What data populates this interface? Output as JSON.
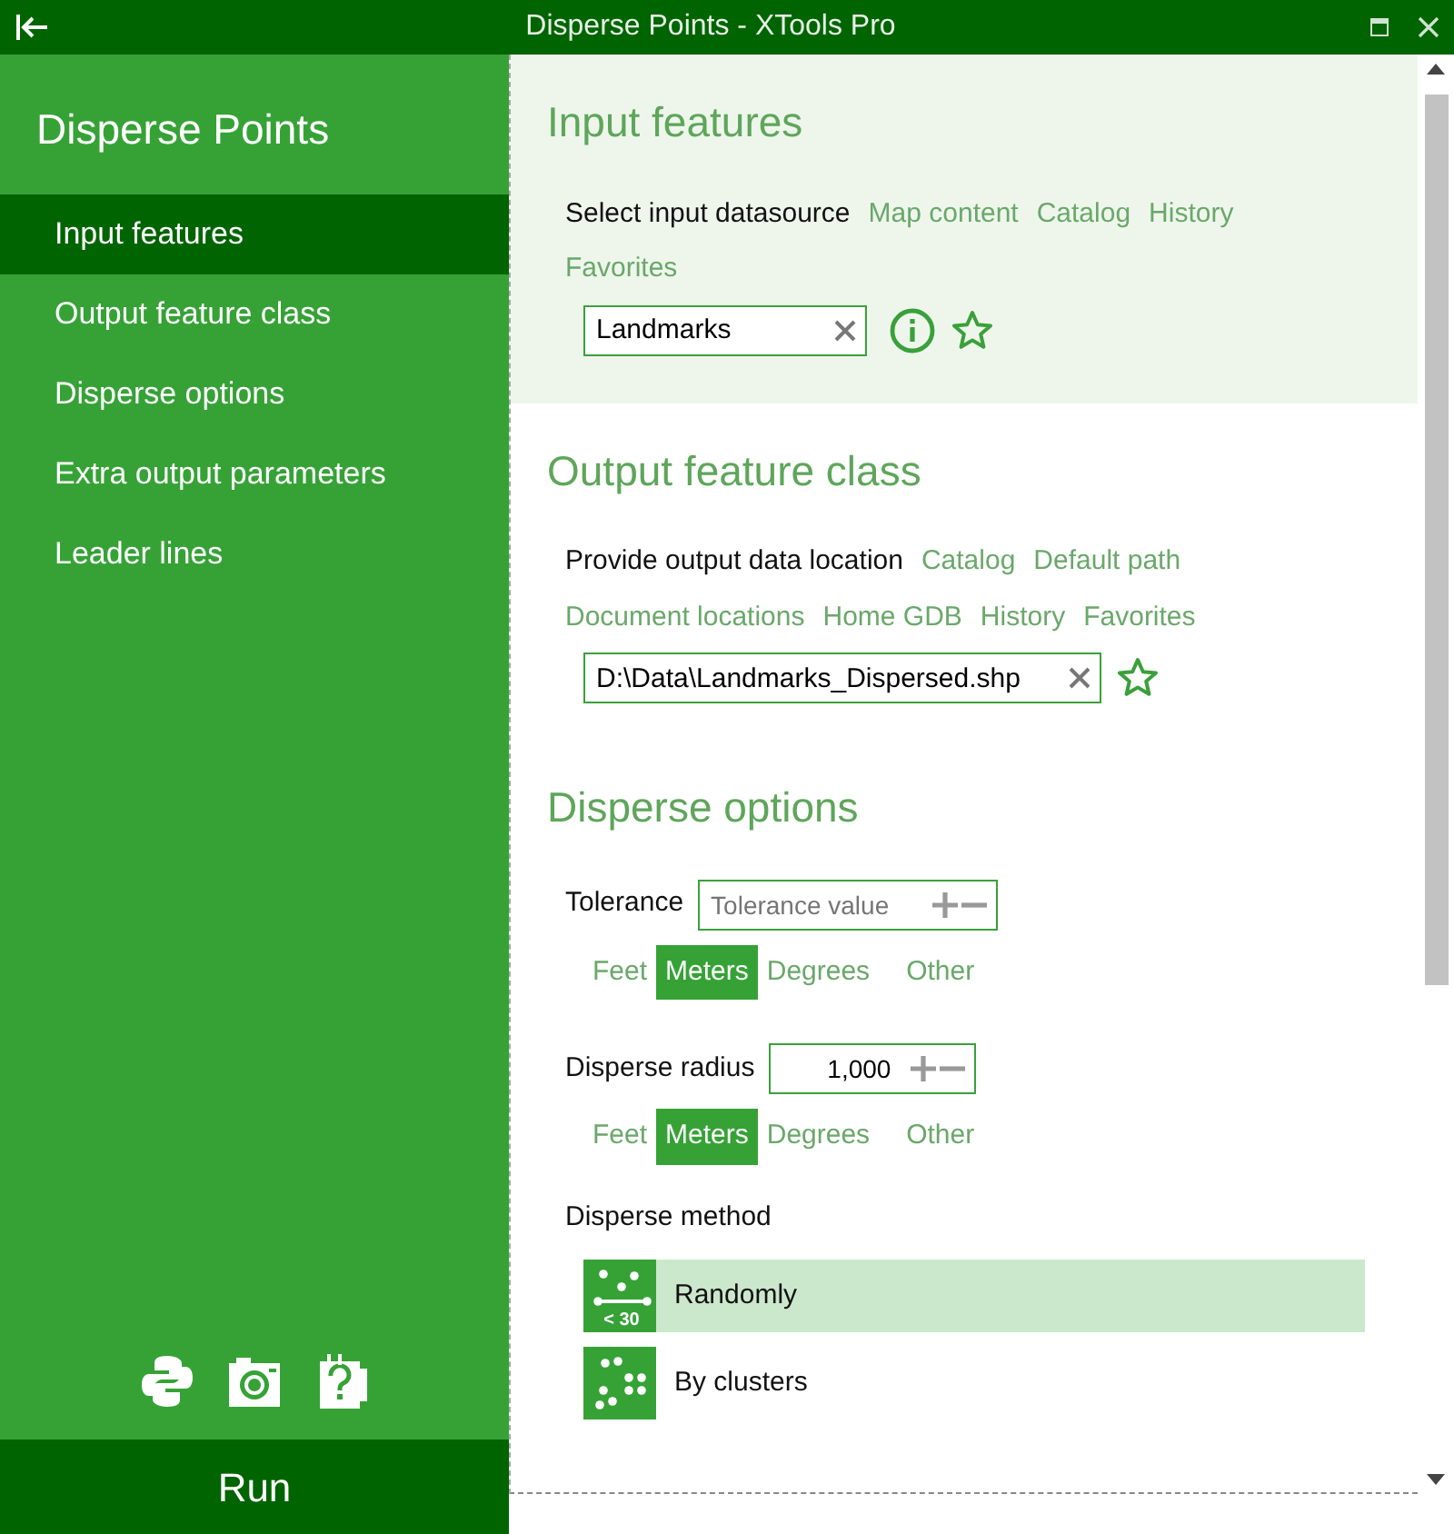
{
  "window": {
    "title": "Disperse Points - XTools Pro"
  },
  "sidebar": {
    "title": "Disperse Points",
    "items": [
      {
        "label": "Input features",
        "selected": true
      },
      {
        "label": "Output feature class",
        "selected": false
      },
      {
        "label": "Disperse options",
        "selected": false
      },
      {
        "label": "Extra output parameters",
        "selected": false
      },
      {
        "label": "Leader lines",
        "selected": false
      }
    ],
    "run_label": "Run"
  },
  "input_features": {
    "title": "Input features",
    "highlighted": true,
    "prompt": "Select input datasource",
    "links": [
      "Map content",
      "Catalog",
      "History",
      "Favorites"
    ],
    "field": {
      "value": "Landmarks"
    },
    "info": true
  },
  "output_feature_class": {
    "title": "Output feature class",
    "highlighted": false,
    "prompt": "Provide output data location",
    "links": [
      "Catalog",
      "Default path",
      "Document locations",
      "Home GDB",
      "History",
      "Favorites"
    ],
    "field": {
      "value": "D:\\Data\\Landmarks_Dispersed.shp"
    },
    "info": false
  },
  "disperse_options": {
    "title": "Disperse options",
    "tolerance": {
      "label": "Tolerance",
      "placeholder": "Tolerance value",
      "units": [
        {
          "label": "Feet",
          "selected": false
        },
        {
          "label": "Meters",
          "selected": true
        },
        {
          "label": "Degrees",
          "selected": false
        },
        {
          "label": "Other",
          "selected": false
        }
      ]
    },
    "radius": {
      "label": "Disperse radius",
      "value": "1,000",
      "units": [
        {
          "label": "Feet",
          "selected": false
        },
        {
          "label": "Meters",
          "selected": true
        },
        {
          "label": "Degrees",
          "selected": false
        },
        {
          "label": "Other",
          "selected": false
        }
      ]
    },
    "method": {
      "label": "Disperse method",
      "options": [
        {
          "label": "Randomly",
          "selected": true,
          "kind": "random",
          "icon_text": "< 30"
        },
        {
          "label": "By clusters",
          "selected": false,
          "kind": "clusters"
        }
      ]
    }
  }
}
